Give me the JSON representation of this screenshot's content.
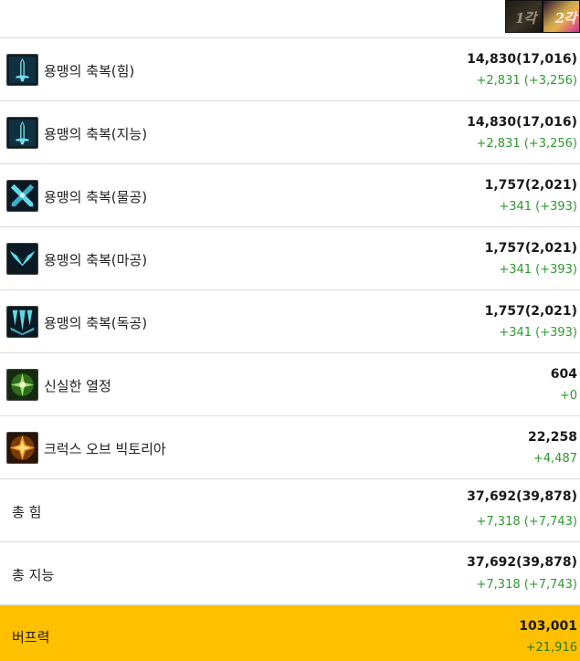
{
  "tabs": [
    {
      "label": "1각"
    },
    {
      "label": "2각"
    }
  ],
  "rows": [
    {
      "name": "용맹의 축복(힘)",
      "value": "14,830(17,016)",
      "increase": "+2,831 (+3,256)",
      "icon": "sword-icon"
    },
    {
      "name": "용맹의 축복(지능)",
      "value": "14,830(17,016)",
      "increase": "+2,831 (+3,256)",
      "icon": "sword-icon"
    },
    {
      "name": "용맹의 축복(물공)",
      "value": "1,757(2,021)",
      "increase": "+341 (+393)",
      "icon": "crossed-swords-icon"
    },
    {
      "name": "용맹의 축복(마공)",
      "value": "1,757(2,021)",
      "increase": "+341 (+393)",
      "icon": "wings-icon"
    },
    {
      "name": "용맹의 축복(독공)",
      "value": "1,757(2,021)",
      "increase": "+341 (+393)",
      "icon": "spikes-icon"
    },
    {
      "name": "신실한 열정",
      "value": "604",
      "increase": "+0",
      "icon": "green-emblem-icon"
    },
    {
      "name": "크럭스 오브 빅토리아",
      "value": "22,258",
      "increase": "+4,487",
      "icon": "gold-cross-icon"
    },
    {
      "name": "총 힘",
      "value": "37,692(39,878)",
      "increase": "+7,318 (+7,743)"
    },
    {
      "name": "총 지능",
      "value": "37,692(39,878)",
      "increase": "+7,318 (+7,743)"
    }
  ],
  "buff": {
    "name": "버프력",
    "value": "103,001",
    "increase": "+21,916"
  },
  "colors": {
    "increase": "#2e9a2e",
    "buff_bg": "#ffc000",
    "divider": "#dcdcdc"
  }
}
